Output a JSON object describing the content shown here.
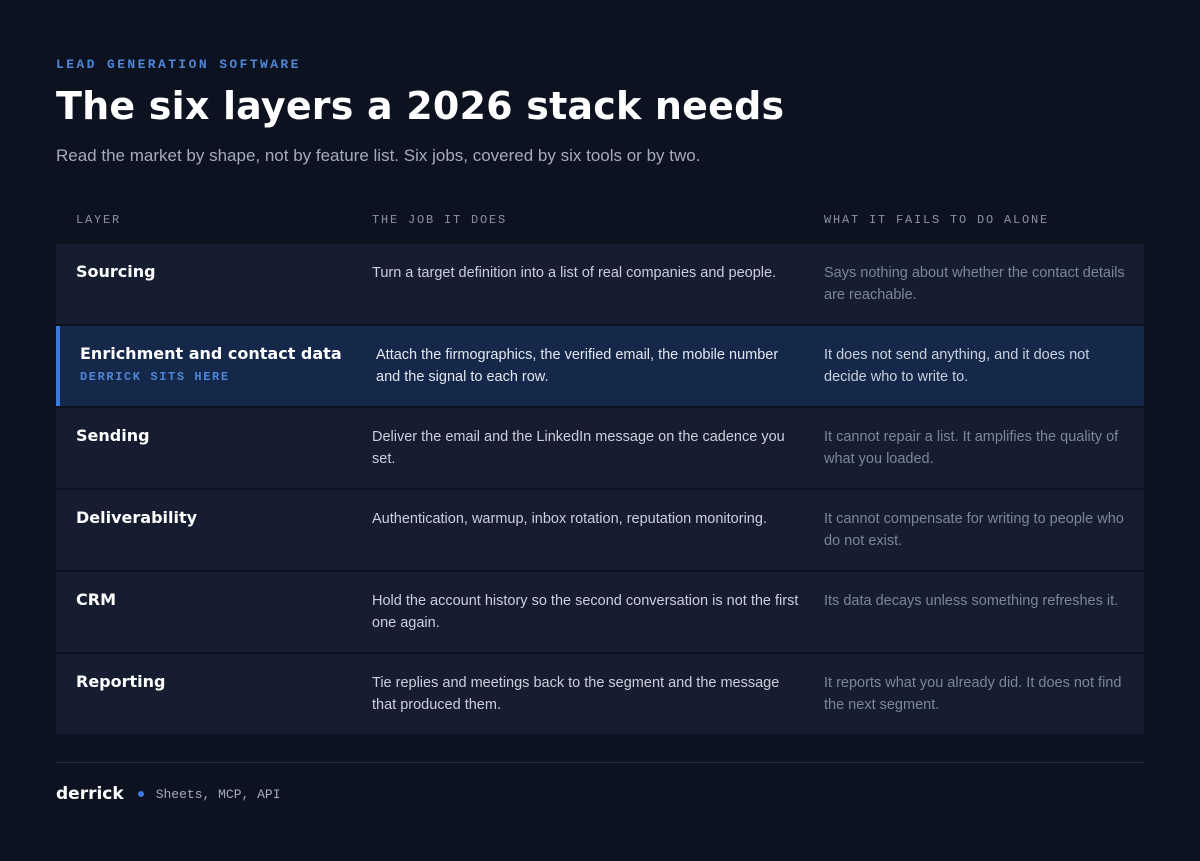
{
  "header": {
    "eyebrow": "LEAD GENERATION SOFTWARE",
    "title": "The six layers a 2026 stack needs",
    "subtitle": "Read the market by shape, not by feature list. Six jobs, covered by six tools or by two."
  },
  "table": {
    "columns": [
      "LAYER",
      "THE JOB IT DOES",
      "WHAT IT FAILS TO DO ALONE"
    ],
    "rows": [
      {
        "layer": "Sourcing",
        "tag": "",
        "job": "Turn a target definition into a list of real companies and people.",
        "fails": "Says nothing about whether the contact details are reachable."
      },
      {
        "layer": "Enrichment and contact data",
        "tag": "DERRICK SITS HERE",
        "job": "Attach the firmographics, the verified email, the mobile number and the signal to each row.",
        "fails": "It does not send anything, and it does not decide who to write to."
      },
      {
        "layer": "Sending",
        "tag": "",
        "job": "Deliver the email and the LinkedIn message on the cadence you set.",
        "fails": "It cannot repair a list. It amplifies the quality of what you loaded."
      },
      {
        "layer": "Deliverability",
        "tag": "",
        "job": "Authentication, warmup, inbox rotation, reputation monitoring.",
        "fails": "It cannot compensate for writing to people who do not exist."
      },
      {
        "layer": "CRM",
        "tag": "",
        "job": "Hold the account history so the second conversation is not the first one again.",
        "fails": "Its data decays unless something refreshes it."
      },
      {
        "layer": "Reporting",
        "tag": "",
        "job": "Tie replies and meetings back to the segment and the message that produced them.",
        "fails": "It reports what you already did. It does not find the next segment."
      }
    ]
  },
  "footer": {
    "brand": "derrick",
    "channels": "Sheets, MCP, API"
  },
  "colors": {
    "background": "#0c1220",
    "accent": "#3a7ae0",
    "row": "#161d30",
    "row_highlight": "#15284a"
  }
}
